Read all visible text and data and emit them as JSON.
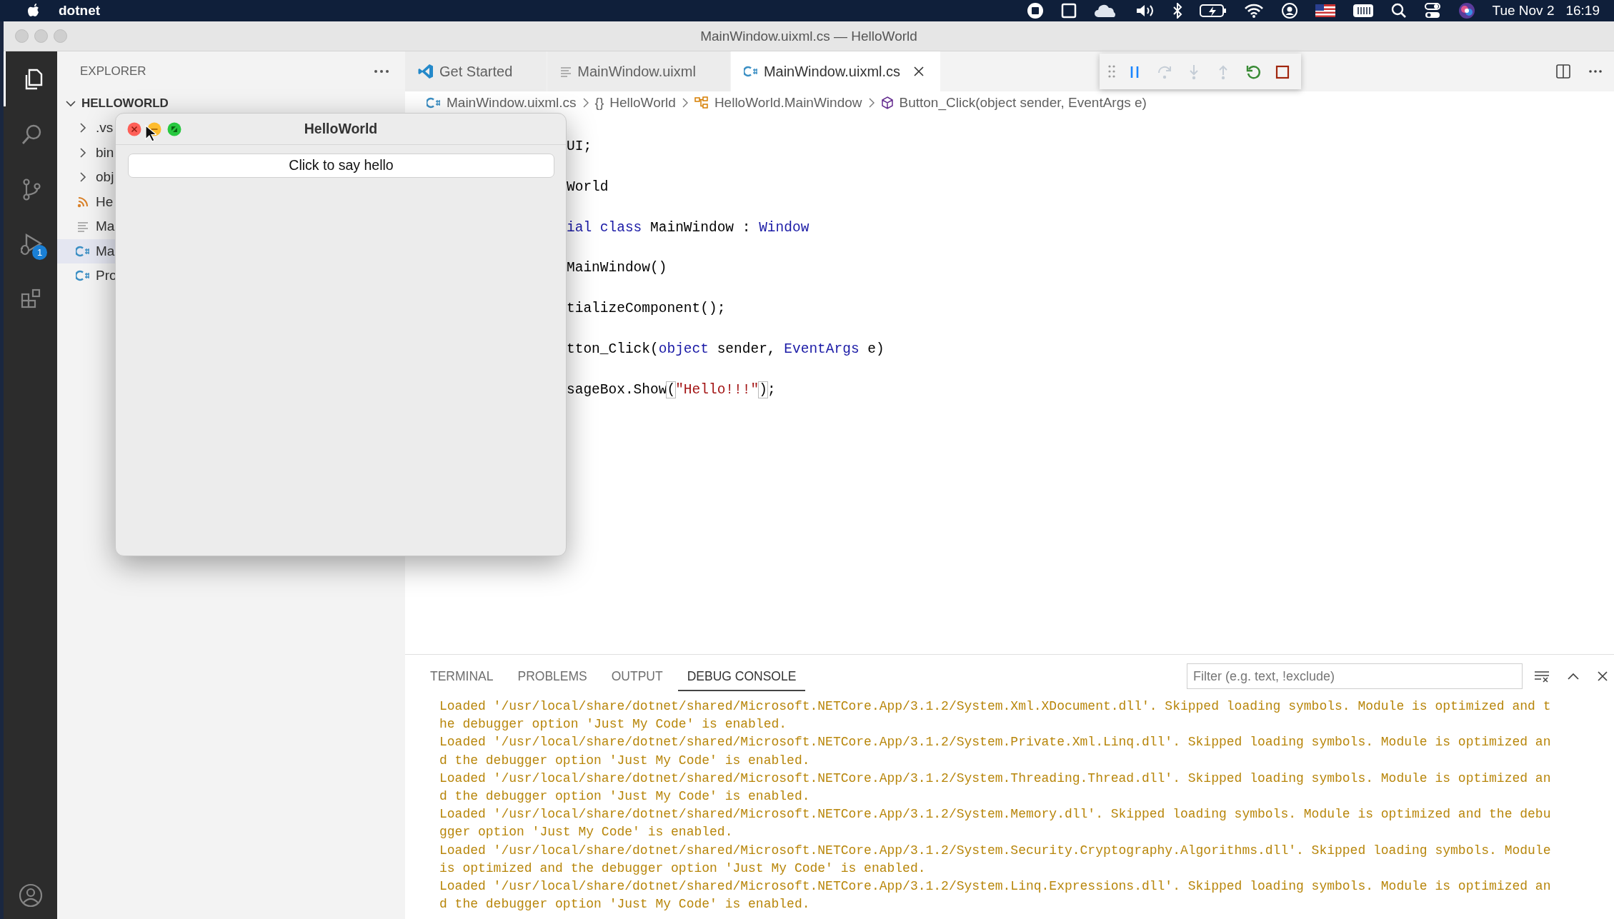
{
  "menu_bar": {
    "app": "dotnet",
    "date": "Tue Nov 2",
    "time": "16:19"
  },
  "window": {
    "title": "MainWindow.uixml.cs — HelloWorld"
  },
  "activity_bar": {
    "items": [
      {
        "kind": "files",
        "selected": true
      },
      {
        "kind": "search",
        "selected": false
      },
      {
        "kind": "source_control",
        "selected": false
      },
      {
        "kind": "debug",
        "selected": false,
        "badge": "1"
      },
      {
        "kind": "extensions",
        "selected": false
      }
    ]
  },
  "sidebar": {
    "title": "EXPLORER",
    "root": {
      "label": "HELLOWORLD",
      "expanded": true,
      "children": [
        {
          "kind": "folder",
          "label": ".vs",
          "expanded": false,
          "selected": false
        },
        {
          "kind": "folder",
          "label": "bin",
          "expanded": false,
          "selected": false
        },
        {
          "kind": "folder",
          "label": "obj",
          "expanded": false,
          "selected": false
        },
        {
          "kind": "project",
          "label": "He",
          "selected": false
        },
        {
          "kind": "markup",
          "label": "Ma",
          "selected": false
        },
        {
          "kind": "csharp",
          "label": "Ma",
          "selected": true
        },
        {
          "kind": "csharp",
          "label": "Pro",
          "selected": false
        }
      ]
    }
  },
  "editor_tabs": [
    {
      "kind": "welcome",
      "label": "Get Started",
      "selected": false
    },
    {
      "kind": "markup",
      "label": "MainWindow.uixml",
      "selected": false
    },
    {
      "kind": "csharp",
      "label": "MainWindow.uixml.cs",
      "selected": true
    }
  ],
  "debug_toolbar": {
    "buttons": [
      {
        "kind": "pause",
        "disabled": false
      },
      {
        "kind": "step_over",
        "disabled": true
      },
      {
        "kind": "step_into",
        "disabled": true
      },
      {
        "kind": "step_out",
        "disabled": true
      },
      {
        "kind": "restart",
        "disabled": false
      },
      {
        "kind": "stop",
        "disabled": false
      }
    ]
  },
  "breadcrumbs": [
    {
      "kind": "file",
      "label": "MainWindow.uixml.cs"
    },
    {
      "kind": "namespace",
      "symbol": "{}",
      "label": "HelloWorld"
    },
    {
      "kind": "class",
      "label": "HelloWorld.MainWindow"
    },
    {
      "kind": "method",
      "label": "Button_Click(object sender, EventArgs e)"
    }
  ],
  "code_lines": [
    {
      "tokens": [
        {
          "kind": "plain",
          "text": "UI;"
        }
      ]
    },
    {
      "tokens": [
        {
          "kind": "plain",
          "text": "World"
        }
      ]
    },
    {
      "tokens": [
        {
          "kind": "keyword",
          "text": "ial class"
        },
        {
          "kind": "plain",
          "text": " MainWindow : "
        },
        {
          "kind": "type",
          "text": "Window"
        }
      ]
    },
    {
      "tokens": [
        {
          "kind": "plain",
          "text": "MainWindow()"
        }
      ]
    },
    {
      "tokens": [
        {
          "kind": "plain",
          "text": "tializeComponent();"
        }
      ]
    },
    {
      "tokens": [
        {
          "kind": "plain",
          "text": "tton_Click("
        },
        {
          "kind": "keyword",
          "text": "object"
        },
        {
          "kind": "plain",
          "text": " sender, "
        },
        {
          "kind": "type",
          "text": "EventArgs"
        },
        {
          "kind": "plain",
          "text": " e)"
        }
      ]
    },
    {
      "tokens": [
        {
          "kind": "plain",
          "text": "sageBox.Show"
        },
        {
          "kind": "bracket",
          "text": "("
        },
        {
          "kind": "string",
          "text": "\"Hello!!!\""
        },
        {
          "kind": "bracket",
          "text": ")"
        },
        {
          "kind": "plain",
          "text": ";"
        }
      ]
    }
  ],
  "hello_window": {
    "title": "HelloWorld",
    "button": "Click to say hello"
  },
  "panel": {
    "tabs": [
      {
        "label": "TERMINAL",
        "selected": false
      },
      {
        "label": "PROBLEMS",
        "selected": false
      },
      {
        "label": "OUTPUT",
        "selected": false
      },
      {
        "label": "DEBUG CONSOLE",
        "selected": true
      }
    ],
    "filter": {
      "placeholder": "Filter (e.g. text, !exclude)"
    },
    "console_lines": [
      "Loaded '/usr/local/share/dotnet/shared/Microsoft.NETCore.App/3.1.2/System.Xml.XDocument.dll'. Skipped loading symbols. Module is optimized and t",
      "he debugger option 'Just My Code' is enabled.",
      "Loaded '/usr/local/share/dotnet/shared/Microsoft.NETCore.App/3.1.2/System.Private.Xml.Linq.dll'. Skipped loading symbols. Module is optimized an",
      "d the debugger option 'Just My Code' is enabled.",
      "Loaded '/usr/local/share/dotnet/shared/Microsoft.NETCore.App/3.1.2/System.Threading.Thread.dll'. Skipped loading symbols. Module is optimized an",
      "d the debugger option 'Just My Code' is enabled.",
      "Loaded '/usr/local/share/dotnet/shared/Microsoft.NETCore.App/3.1.2/System.Memory.dll'. Skipped loading symbols. Module is optimized and the debu",
      "gger option 'Just My Code' is enabled.",
      "Loaded '/usr/local/share/dotnet/shared/Microsoft.NETCore.App/3.1.2/System.Security.Cryptography.Algorithms.dll'. Skipped loading symbols. Module",
      "is optimized and the debugger option 'Just My Code' is enabled.",
      "Loaded '/usr/local/share/dotnet/shared/Microsoft.NETCore.App/3.1.2/System.Linq.Expressions.dll'. Skipped loading symbols. Module is optimized an",
      "d the debugger option 'Just My Code' is enabled."
    ]
  }
}
